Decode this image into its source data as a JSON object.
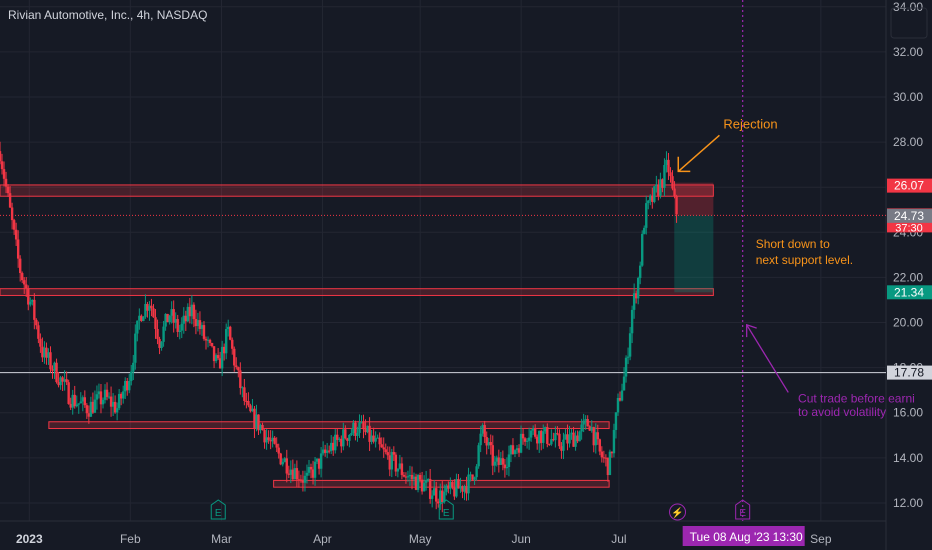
{
  "chart_data": {
    "type": "candlestick",
    "title": "Rivian Automotive, Inc., 4h, NASDAQ",
    "ylim": [
      11.2,
      34.3
    ],
    "y_ticks": [
      "12.00",
      "14.00",
      "16.00",
      "18.00",
      "20.00",
      "22.00",
      "24.00",
      "26.00",
      "28.00",
      "30.00",
      "32.00",
      "34.00"
    ],
    "x_ticks": [
      "2023",
      "Feb",
      "Mar",
      "Apr",
      "May",
      "Jun",
      "Jul",
      "Sep"
    ],
    "x_range": [
      "2022-12-23",
      "2023-09-21"
    ],
    "x_tick_dates": [
      "2023-01-01",
      "2023-02-01",
      "2023-03-01",
      "2023-04-01",
      "2023-05-01",
      "2023-06-01",
      "2023-07-01",
      "2023-09-01"
    ],
    "price_path": [
      [
        "2022-12-23",
        27.6
      ],
      [
        "2022-12-26",
        25.0
      ],
      [
        "2022-12-29",
        22.4
      ],
      [
        "2023-01-02",
        20.6
      ],
      [
        "2023-01-05",
        18.7
      ],
      [
        "2023-01-10",
        17.6
      ],
      [
        "2023-01-14",
        16.6
      ],
      [
        "2023-01-19",
        16.2
      ],
      [
        "2023-01-24",
        16.7
      ],
      [
        "2023-01-28",
        16.2
      ],
      [
        "2023-02-01",
        17.8
      ],
      [
        "2023-02-04",
        20.4
      ],
      [
        "2023-02-07",
        21.0
      ],
      [
        "2023-02-10",
        19.2
      ],
      [
        "2023-02-13",
        20.4
      ],
      [
        "2023-02-16",
        19.6
      ],
      [
        "2023-02-20",
        20.6
      ],
      [
        "2023-02-24",
        19.2
      ],
      [
        "2023-02-28",
        18.0
      ],
      [
        "2023-03-03",
        19.6
      ],
      [
        "2023-03-06",
        17.6
      ],
      [
        "2023-03-09",
        16.0
      ],
      [
        "2023-03-13",
        15.4
      ],
      [
        "2023-03-17",
        14.4
      ],
      [
        "2023-03-22",
        13.6
      ],
      [
        "2023-03-27",
        13.0
      ],
      [
        "2023-04-03",
        14.4
      ],
      [
        "2023-04-08",
        15.0
      ],
      [
        "2023-04-12",
        15.4
      ],
      [
        "2023-04-16",
        14.8
      ],
      [
        "2023-04-21",
        14.0
      ],
      [
        "2023-04-27",
        13.2
      ],
      [
        "2023-05-02",
        12.8
      ],
      [
        "2023-05-07",
        12.3
      ],
      [
        "2023-05-12",
        12.6
      ],
      [
        "2023-05-17",
        13.0
      ],
      [
        "2023-05-20",
        15.2
      ],
      [
        "2023-05-24",
        13.6
      ],
      [
        "2023-05-29",
        14.2
      ],
      [
        "2023-06-03",
        15.2
      ],
      [
        "2023-06-08",
        15.0
      ],
      [
        "2023-06-13",
        14.6
      ],
      [
        "2023-06-18",
        15.0
      ],
      [
        "2023-06-22",
        15.6
      ],
      [
        "2023-06-25",
        14.2
      ],
      [
        "2023-06-28",
        13.6
      ],
      [
        "2023-07-01",
        16.6
      ],
      [
        "2023-07-03",
        17.8
      ],
      [
        "2023-07-05",
        20.5
      ],
      [
        "2023-07-07",
        22.0
      ],
      [
        "2023-07-09",
        24.8
      ],
      [
        "2023-07-11",
        25.4
      ],
      [
        "2023-07-14",
        26.2
      ],
      [
        "2023-07-16",
        27.0
      ],
      [
        "2023-07-18",
        25.3
      ],
      [
        "2023-07-19",
        24.75
      ]
    ],
    "price_lines": [
      {
        "value": 26.07,
        "label": "26.07",
        "color": "#f23645"
      },
      {
        "value": 24.75,
        "label": "24.75",
        "sublabel": "37:30",
        "color": "#f23645"
      },
      {
        "value": 24.73,
        "label": "24.73",
        "color": "#787b86"
      },
      {
        "value": 21.34,
        "label": "21.34",
        "color": "#089981"
      },
      {
        "value": 17.78,
        "label": "17.78",
        "color": "#d1d4dc"
      }
    ],
    "zones": [
      {
        "name": "resistance",
        "x": [
          "2022-12-23",
          "2023-07-30"
        ],
        "y": [
          25.6,
          26.1
        ]
      },
      {
        "name": "support-target",
        "x": [
          "2022-12-23",
          "2023-07-30"
        ],
        "y": [
          21.2,
          21.5
        ]
      },
      {
        "name": "range-top",
        "x": [
          "2023-01-07",
          "2023-06-28"
        ],
        "y": [
          15.3,
          15.6
        ]
      },
      {
        "name": "range-bottom",
        "x": [
          "2023-03-17",
          "2023-06-28"
        ],
        "y": [
          12.7,
          13.0
        ]
      }
    ],
    "position": {
      "x": [
        "2023-07-18",
        "2023-07-30"
      ],
      "entry": 24.75,
      "stop": 26.2,
      "target": 21.34
    },
    "annotations": [
      {
        "text": "Rejection",
        "color": "#f7931a"
      },
      {
        "text": "Short down to",
        "color": "#f7931a"
      },
      {
        "text": "next support level.",
        "color": "#f7931a"
      },
      {
        "text": "Cut trade before earni",
        "color": "#9c27b0"
      },
      {
        "text": "to avoid volatility",
        "color": "#9c27b0"
      }
    ],
    "earnings_markers": [
      "E",
      "E",
      "E"
    ],
    "earnings_dates": [
      "2023-02-28",
      "2023-05-09",
      "2023-08-08"
    ],
    "earnings_line_date": "2023-08-08",
    "dividend_marker": "⚡",
    "dividend_marker_date": "2023-07-19",
    "crosshair_date_label": "Tue 08 Aug '23",
    "crosshair_time_label": "13:30",
    "grid": true
  },
  "colors": {
    "up": "#089981",
    "down": "#f23645",
    "bg": "#161a25",
    "grid": "#232632",
    "axis_text": "#b2b5be",
    "earnings": "#9c27b0",
    "orange": "#f7931a"
  }
}
